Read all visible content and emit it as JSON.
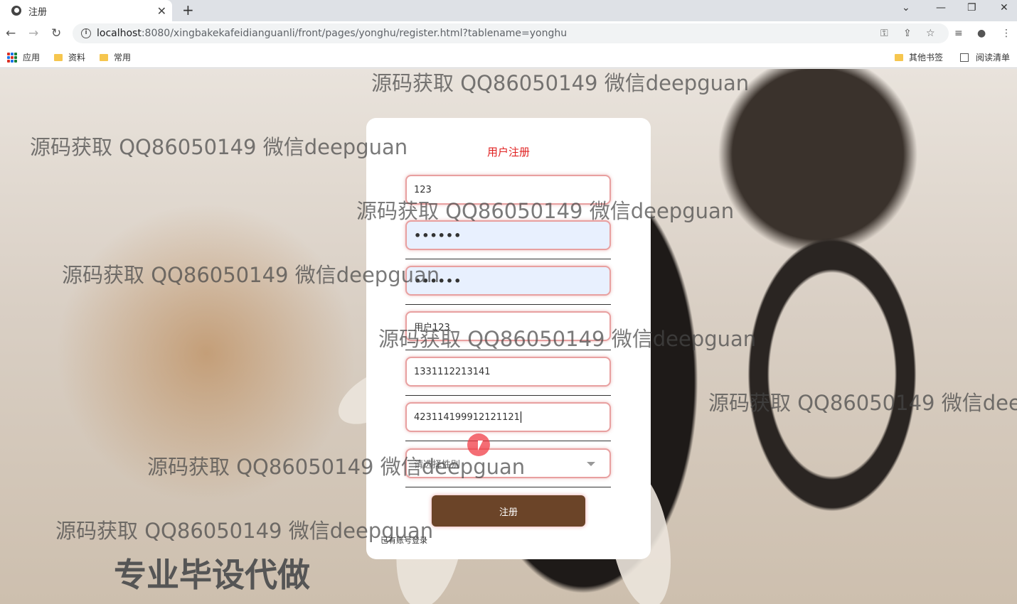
{
  "browser": {
    "tab_title": "注册",
    "url_host": "localhost",
    "url_path": ":8080/xingbakekafeidianguanli/front/pages/yonghu/register.html?tablename=yonghu",
    "bookmarks": {
      "apps": "应用",
      "folder1": "资料",
      "folder2": "常用",
      "other": "其他书签",
      "reading_list": "阅读清单"
    }
  },
  "form": {
    "title": "用户注册",
    "account": "123",
    "password": "••••••",
    "password_confirm": "••••••",
    "name": "用户123",
    "phone": "1331112213141",
    "id_card": "423114199912121121",
    "gender_placeholder": "请选择性别",
    "submit_label": "注册",
    "login_link": "已有账号登录"
  },
  "watermarks": {
    "text": "源码获取 QQ86050149 微信deepguan",
    "big": "专业毕设代做"
  }
}
